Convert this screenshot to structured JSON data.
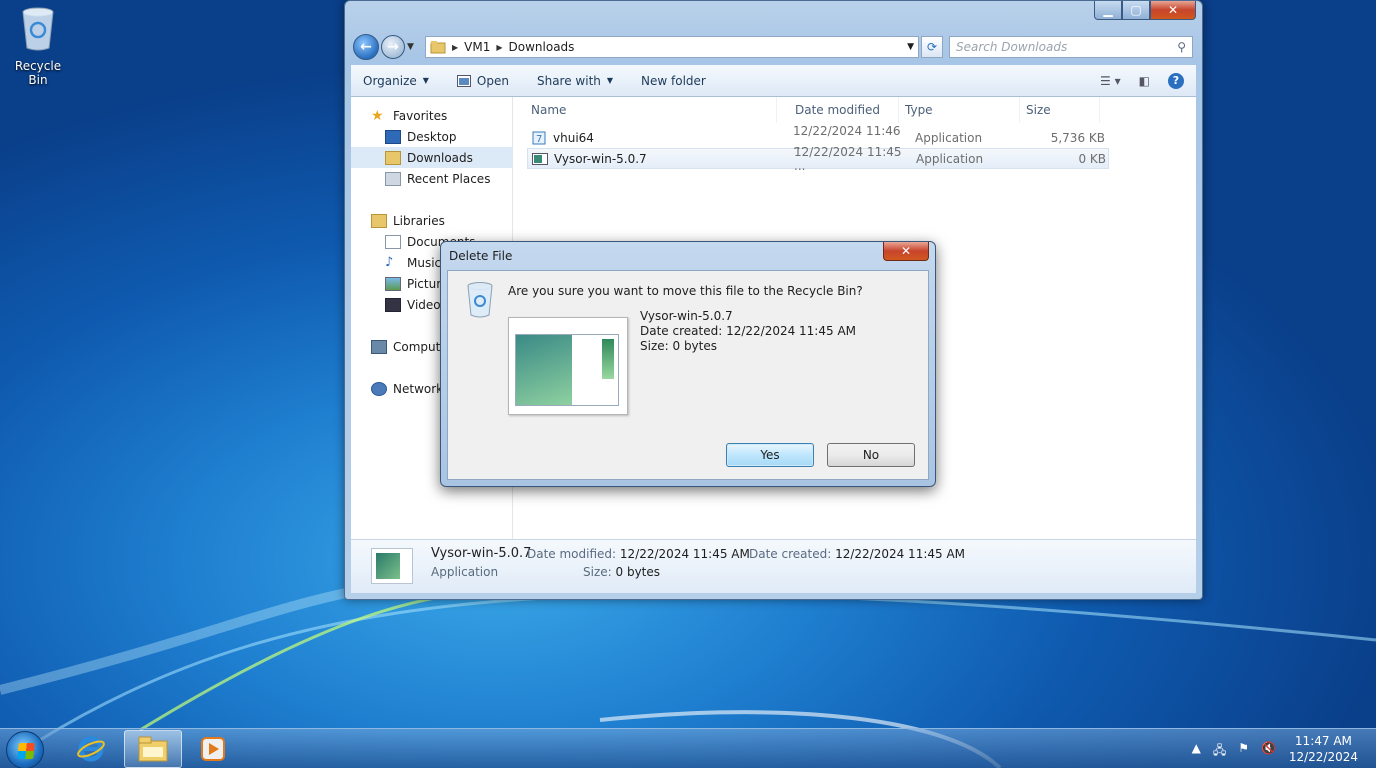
{
  "desktop": {
    "recycle_bin_label": "Recycle Bin"
  },
  "explorer": {
    "breadcrumb": [
      "VM1",
      "Downloads"
    ],
    "search_placeholder": "Search Downloads",
    "toolbar": {
      "organize": "Organize",
      "open": "Open",
      "share_with": "Share with",
      "new_folder": "New folder"
    },
    "nav": {
      "favorites": "Favorites",
      "desktop": "Desktop",
      "downloads": "Downloads",
      "recent_places": "Recent Places",
      "libraries": "Libraries",
      "documents": "Documents",
      "music": "Music",
      "pictures": "Pictures",
      "videos": "Videos",
      "computer": "Computer",
      "network": "Network"
    },
    "columns": {
      "name": "Name",
      "date_modified": "Date modified",
      "type": "Type",
      "size": "Size"
    },
    "files": [
      {
        "name": "vhui64",
        "date_modified": "12/22/2024 11:46 ...",
        "type": "Application",
        "size": "5,736 KB"
      },
      {
        "name": "Vysor-win-5.0.7",
        "date_modified": "12/22/2024 11:45 ...",
        "type": "Application",
        "size": "0 KB"
      }
    ],
    "details": {
      "name": "Vysor-win-5.0.7",
      "type": "Application",
      "date_modified_label": "Date modified:",
      "date_modified": "12/22/2024 11:45 AM",
      "date_created_label": "Date created:",
      "date_created": "12/22/2024 11:45 AM",
      "size_label": "Size:",
      "size": "0 bytes"
    }
  },
  "dialog": {
    "title": "Delete File",
    "question": "Are you sure you want to move this file to the Recycle Bin?",
    "file_name": "Vysor-win-5.0.7",
    "date_created": "Date created: 12/22/2024 11:45 AM",
    "size": "Size: 0 bytes",
    "yes": "Yes",
    "no": "No"
  },
  "taskbar": {
    "time": "11:47 AM",
    "date": "12/22/2024"
  }
}
